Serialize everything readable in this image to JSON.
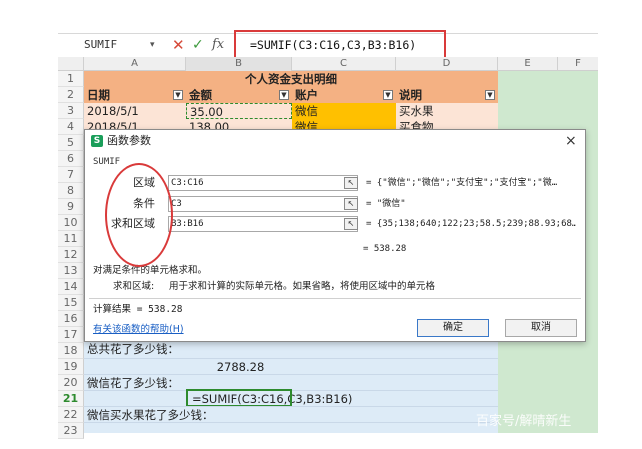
{
  "formula_bar": {
    "name_box": "SUMIF",
    "formula": "=SUMIF(C3:C16,C3,B3:B16)",
    "fx_label": "fx"
  },
  "columns": [
    "A",
    "B",
    "C",
    "D",
    "E",
    "F"
  ],
  "rows": [
    "1",
    "2",
    "3",
    "4",
    "5",
    "6",
    "7",
    "8",
    "9",
    "10",
    "11",
    "12",
    "13",
    "14",
    "15",
    "16",
    "17",
    "18",
    "19",
    "20",
    "21",
    "22",
    "23"
  ],
  "sheet": {
    "title": "个人资金支出明细",
    "headers": [
      "日期",
      "金额",
      "账户",
      "说明"
    ],
    "row3": [
      "2018/5/1",
      "35.00",
      "微信",
      "买水果"
    ],
    "row4": [
      "2018/5/1",
      "138.00",
      "微信",
      "买食物"
    ],
    "row18_text": "总共花了多少钱：",
    "row19_value": "2788.28",
    "row20_text": "微信花了多少钱：",
    "row21_formula": "=SUMIF(C3:C16,C3,B3:B16)",
    "row22_text": "微信买水果花了多少钱："
  },
  "dialog": {
    "title": "函数参数",
    "close": "×",
    "app_icon": "S",
    "function_name": "SUMIF",
    "args": [
      {
        "label": "区域",
        "value": "C3:C16",
        "result": "= {\"微信\";\"微信\";\"支付宝\";\"支付宝\";\"微…"
      },
      {
        "label": "条件",
        "value": "C3",
        "result": "= \"微信\""
      },
      {
        "label": "求和区域",
        "value": "B3:B16",
        "result": "= {35;138;640;122;23;58.5;239;88.93;68…"
      }
    ],
    "function_result": "= 538.28",
    "description": "对满足条件的单元格求和。",
    "arg_desc_label": "求和区域:",
    "arg_desc": "用于求和计算的实际单元格。如果省略，将使用区域中的单元格",
    "calc_result": "计算结果 = 538.28",
    "help_link": "有关该函数的帮助(H)",
    "ok": "确定",
    "cancel": "取消"
  },
  "watermark": "百家号/解晴新生",
  "colors": {
    "header_fill": "#f4b183",
    "highlight": "#ffc000",
    "annotation": "#d93a3a"
  }
}
